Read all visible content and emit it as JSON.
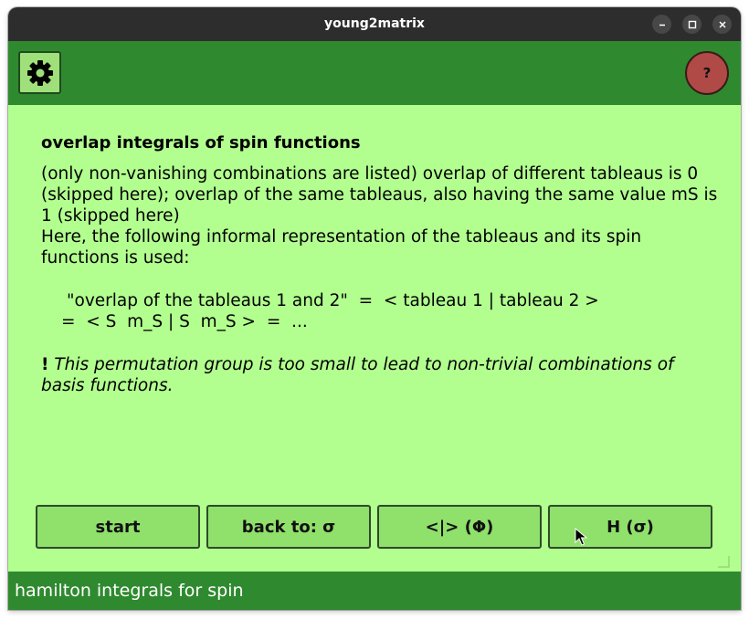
{
  "window": {
    "title": "young2matrix",
    "controls": {
      "minimize_icon": "minimize-icon",
      "maximize_icon": "maximize-icon",
      "close_icon": "close-icon"
    }
  },
  "toolbar": {
    "settings_icon": "gear-icon",
    "help_label": "?"
  },
  "content": {
    "heading": "overlap integrals of spin functions",
    "para1": "(only non-vanishing combinations are listed) overlap of different tableaus is 0 (skipped here); overlap of the same tableaus, also having the same value mS is 1 (skipped here)",
    "para2": "Here, the following informal representation of the tableaus and its spin functions is used:",
    "formula_line1": "\"overlap of the tableaus 1 and 2\"  =  < tableau 1 | tableau 2 >",
    "formula_line2": "=  < S  m_S | S  m_S >  =  ...",
    "note_bang": "!",
    "note_text": "This permutation group is too small to lead to non-trivial combinations of basis functions."
  },
  "navigation": {
    "start_label": "start",
    "back_label": "back to: σ",
    "overlap_label": "<|> (Φ)",
    "hamilton_label": "H (σ)"
  },
  "status": {
    "text": "hamilton integrals for spin"
  },
  "colors": {
    "background": "#b2ff8f",
    "toolbar": "#2f8a2f",
    "button": "#90e06c",
    "help_button": "#b04a47",
    "titlebar": "#2d2d2d"
  }
}
